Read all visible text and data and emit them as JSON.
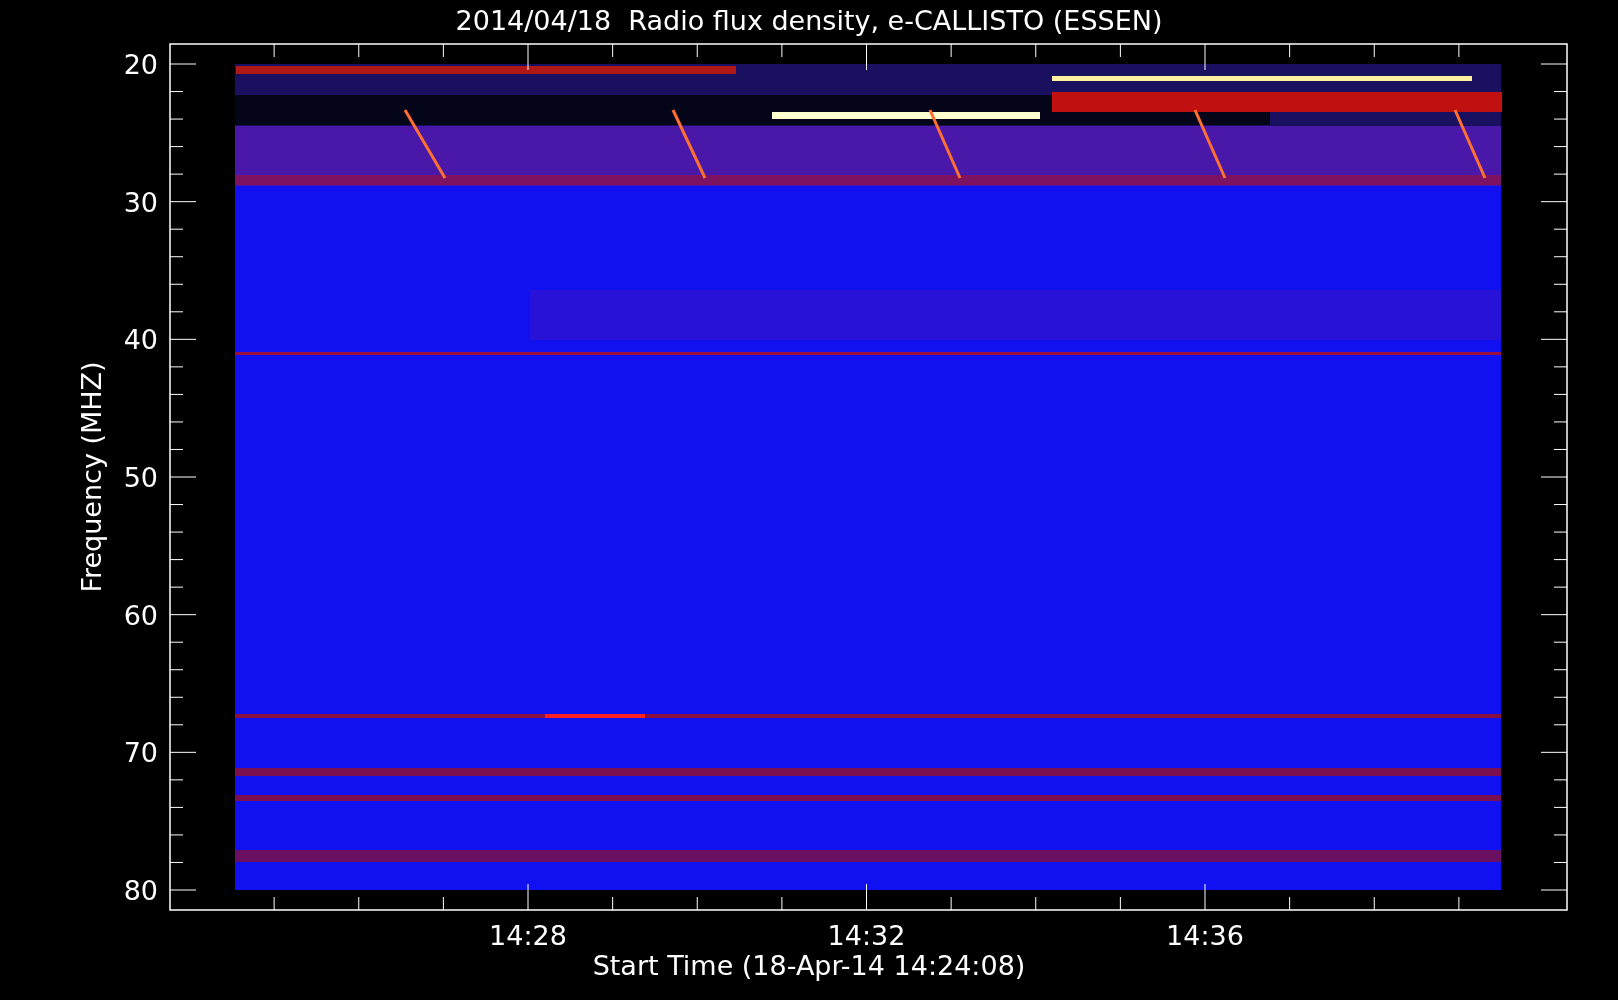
{
  "title": "2014/04/18  Radio flux density, e-CALLISTO (ESSEN)",
  "y_axis": {
    "label": "Frequency (MHZ)",
    "ticks": [
      "20",
      "30",
      "40",
      "50",
      "60",
      "70",
      "80"
    ]
  },
  "x_axis": {
    "label": "Start Time (18-Apr-14 14:24:08)",
    "ticks": [
      "14:28",
      "14:32",
      "14:36"
    ]
  }
}
